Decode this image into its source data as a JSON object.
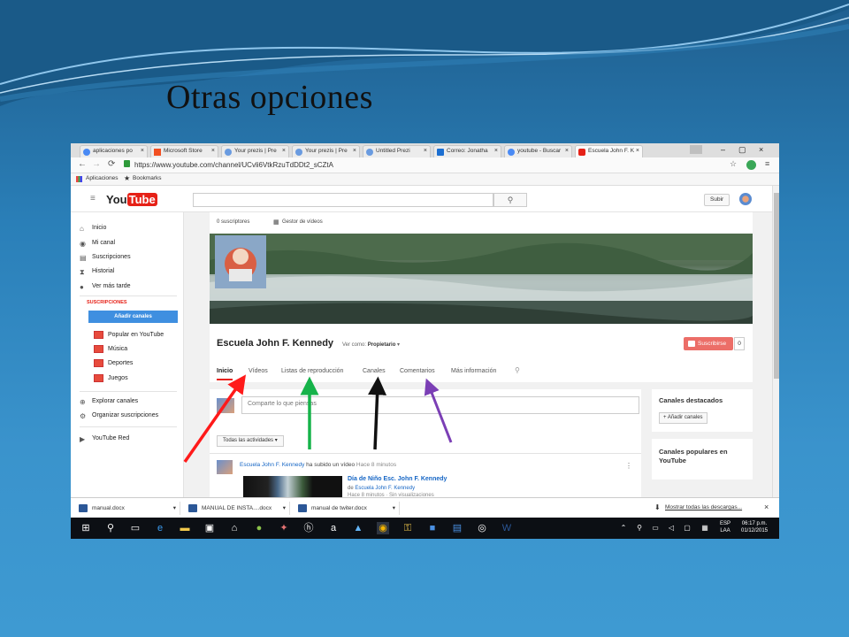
{
  "slide": {
    "title": "Otras opciones"
  },
  "colors": {
    "slide_bg": "#2a7fb8",
    "youtube_red": "#e62117",
    "link_blue": "#1666c5",
    "add_channels_blue": "#3f8fe0",
    "taskbar": "#0c0f14"
  },
  "browser": {
    "tabs": [
      {
        "label": "aplicaciones po",
        "icon": "google-icon"
      },
      {
        "label": "Microsoft Store",
        "icon": "store-icon"
      },
      {
        "label": "Your prezis | Pre",
        "icon": "prezi-icon"
      },
      {
        "label": "Your prezis | Pre",
        "icon": "prezi-icon"
      },
      {
        "label": "Untitled Prezi",
        "icon": "prezi-icon"
      },
      {
        "label": "Correo: Jonatha",
        "icon": "mail-icon"
      },
      {
        "label": "youtube - Buscar",
        "icon": "google-icon"
      },
      {
        "label": "Escuela John F. K",
        "icon": "youtube-icon",
        "active": true
      }
    ],
    "url": "https://www.youtube.com/channel/UCvli6VtkRzuTdDDt2_sCZtA",
    "bookmarks": {
      "apps": "Aplicaciones",
      "bookmarks": "Bookmarks"
    }
  },
  "youtube": {
    "logo_you": "You",
    "logo_tube": "Tube",
    "search_placeholder": "",
    "upload": "Subir",
    "sidebar": {
      "nav": [
        {
          "label": "Inicio",
          "icon": "home-icon"
        },
        {
          "label": "Mi canal",
          "icon": "person-icon"
        },
        {
          "label": "Suscripciones",
          "icon": "subscriptions-icon"
        },
        {
          "label": "Historial",
          "icon": "history-icon"
        },
        {
          "label": "Ver más tarde",
          "icon": "clock-icon"
        }
      ],
      "subs_header": "SUSCRIPCIONES",
      "add_channels": "Añadir canales",
      "subs": [
        "Popular en YouTube",
        "Música",
        "Deportes",
        "Juegos"
      ],
      "extra": [
        "Explorar canales",
        "Organizar suscripciones"
      ],
      "red": "YouTube Red"
    },
    "channel": {
      "subscribers": "0 suscriptores",
      "video_manager": "Gestor de vídeos",
      "name": "Escuela John F. Kennedy",
      "view_as_label": "Ver como:",
      "view_as_value": "Propietario",
      "subscribe": "Suscribirse",
      "sub_count": "0",
      "tabs": [
        "Inicio",
        "Vídeos",
        "Listas de reproducción",
        "Canales",
        "Comentarios",
        "Más información"
      ]
    },
    "feed": {
      "share_placeholder": "Comparte lo que piensas",
      "all_activities": "Todas las actividades",
      "post": {
        "author": "Escuela John F. Kennedy",
        "action": "ha subido un vídeo",
        "time": "Hace 8 minutos",
        "video_title": "Día de Niño Esc. John F. Kennedy",
        "by_prefix": "de",
        "by": "Escuela John F. Kennedy",
        "meta": "Hace 8 minutos · Sin visualizaciones"
      }
    },
    "right": {
      "featured": "Canales destacados",
      "add_channels": "+ Añadir canales",
      "popular": "Canales populares en YouTube"
    }
  },
  "downloads": {
    "items": [
      "manual.docx",
      "MANUAL DE INSTA....docx",
      "manual de twiter.docx"
    ],
    "show_all": "Mostrar todas las descargas..."
  },
  "taskbar": {
    "lang_1": "ESP",
    "lang_2": "LAA",
    "time": "06:17 p.m.",
    "date": "01/12/2015"
  }
}
